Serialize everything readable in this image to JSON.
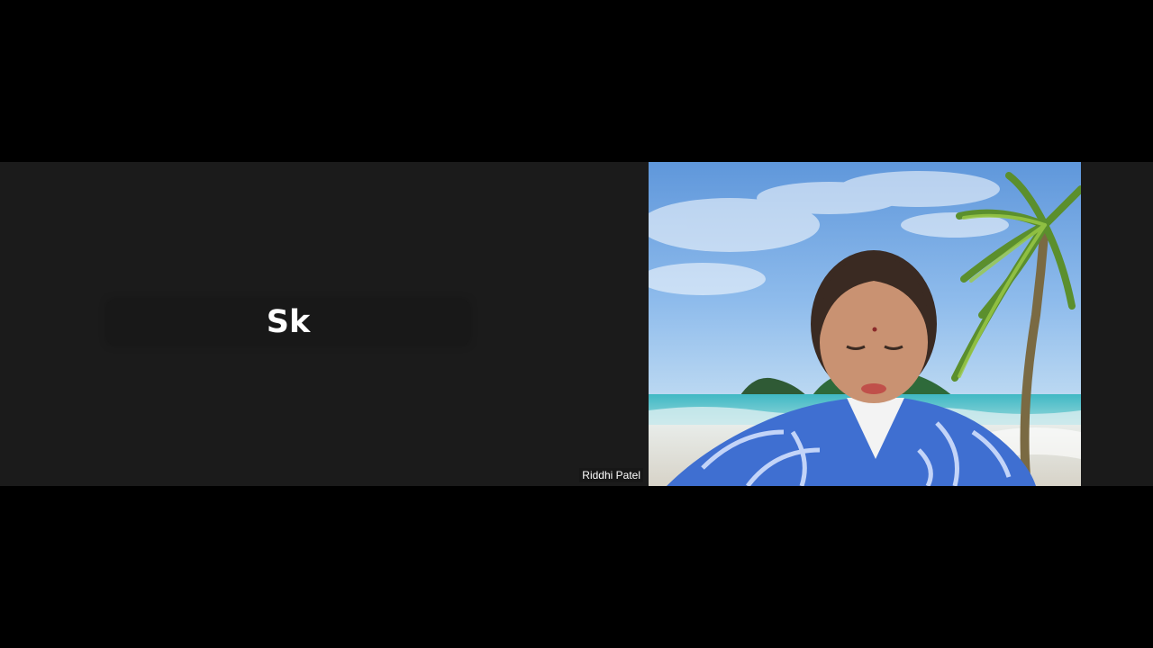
{
  "meeting": {
    "participants": [
      {
        "initials": "Sk",
        "video": "off"
      },
      {
        "name": "Riddhi Patel",
        "video": "on",
        "background": "tropical-beach-virtual-background"
      }
    ]
  },
  "colors": {
    "tile_background": "#1b1b1b",
    "page_background": "#000000",
    "sky": "#7fb0e6",
    "sea": "#7fd3d6",
    "shirt": "#3f6fd1"
  }
}
